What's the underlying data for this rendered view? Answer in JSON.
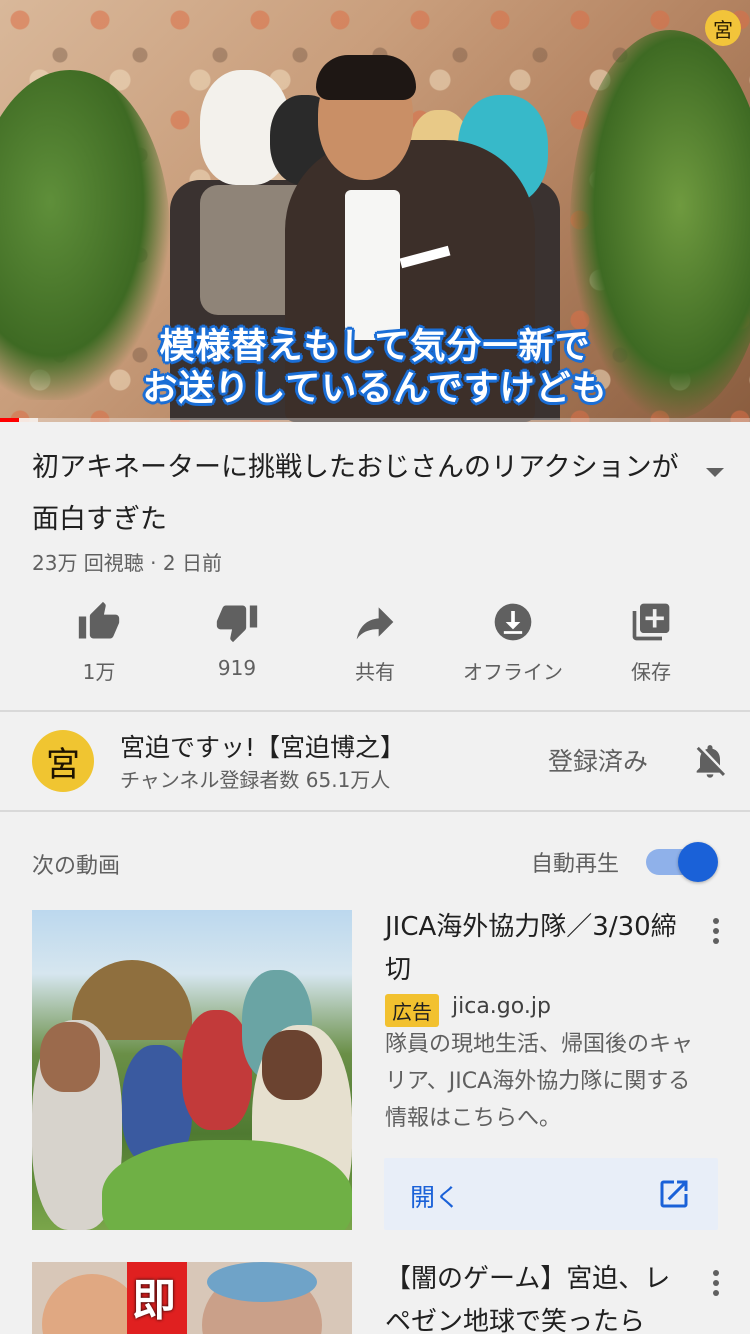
{
  "player": {
    "subtitle_line1": "模様替えもして気分一新で",
    "subtitle_line2": "お送りしているんですけども",
    "watermark": "宮",
    "progress_fraction": 0.025,
    "buffer_fraction": 0.05
  },
  "video": {
    "title": "初アキネーターに挑戦したおじさんのリアクションが面白すぎた",
    "meta": "23万 回視聴 · 2 日前"
  },
  "actions": [
    {
      "label": "1万",
      "icon": "thumb-up-icon"
    },
    {
      "label": "919",
      "icon": "thumb-down-icon"
    },
    {
      "label": "共有",
      "icon": "share-icon"
    },
    {
      "label": "オフライン",
      "icon": "download-icon"
    },
    {
      "label": "保存",
      "icon": "playlist-add-icon"
    }
  ],
  "channel": {
    "avatar_text": "宮",
    "name": "宮迫ですッ!【宮迫博之】",
    "subscribers": "チャンネル登録者数 65.1万人",
    "subscribed_label": "登録済み"
  },
  "upnext": {
    "label": "次の動画",
    "autoplay_label": "自動再生",
    "autoplay_on": true
  },
  "ad": {
    "title": "JICA海外協力隊／3/30締切",
    "badge": "広告",
    "domain": "jica.go.jp",
    "description": "隊員の現地生活、帰国後のキャリア、JICA海外協力隊に関する情報はこちらへ。",
    "open_label": "開く"
  },
  "next_video": {
    "title": "【闇のゲーム】宮迫、レペゼン地球で笑ったら",
    "thumb_text": "即"
  },
  "colors": {
    "accent_blue": "#1a61d8",
    "progress_red": "#ff0000",
    "ad_badge": "#f2c12f"
  }
}
